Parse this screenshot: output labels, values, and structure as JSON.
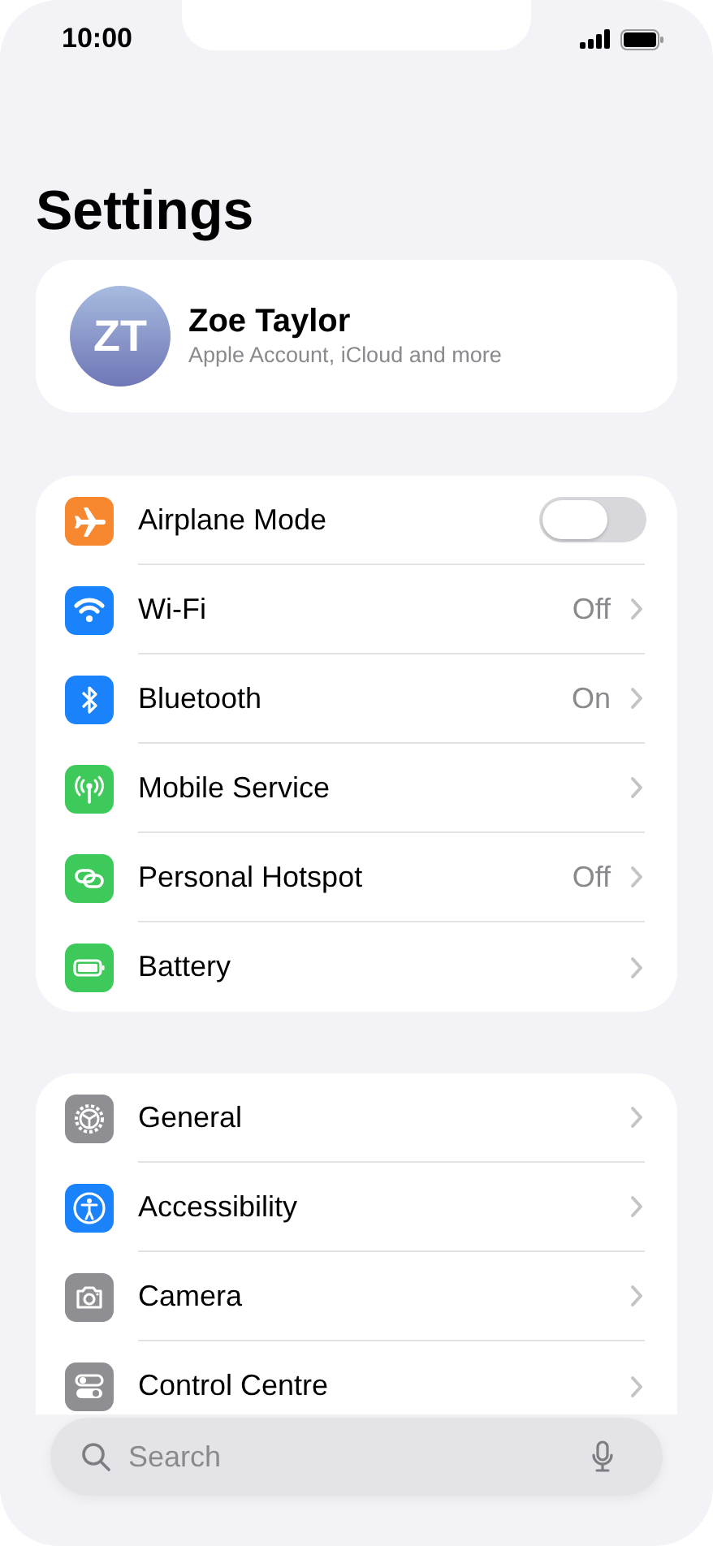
{
  "status_bar": {
    "time": "10:00"
  },
  "title": "Settings",
  "profile": {
    "initials": "ZT",
    "name": "Zoe Taylor",
    "subtitle": "Apple Account, iCloud and more"
  },
  "groups": [
    {
      "rows": [
        {
          "kind": "toggle",
          "label": "Airplane Mode",
          "on": false
        },
        {
          "kind": "nav",
          "label": "Wi-Fi",
          "value": "Off"
        },
        {
          "kind": "nav",
          "label": "Bluetooth",
          "value": "On"
        },
        {
          "kind": "nav",
          "label": "Mobile Service"
        },
        {
          "kind": "nav",
          "label": "Personal Hotspot",
          "value": "Off"
        },
        {
          "kind": "nav",
          "label": "Battery"
        }
      ]
    },
    {
      "rows": [
        {
          "kind": "nav",
          "label": "General"
        },
        {
          "kind": "nav",
          "label": "Accessibility"
        },
        {
          "kind": "nav",
          "label": "Camera"
        },
        {
          "kind": "nav",
          "label": "Control Centre"
        }
      ]
    }
  ],
  "search": {
    "placeholder": "Search"
  }
}
